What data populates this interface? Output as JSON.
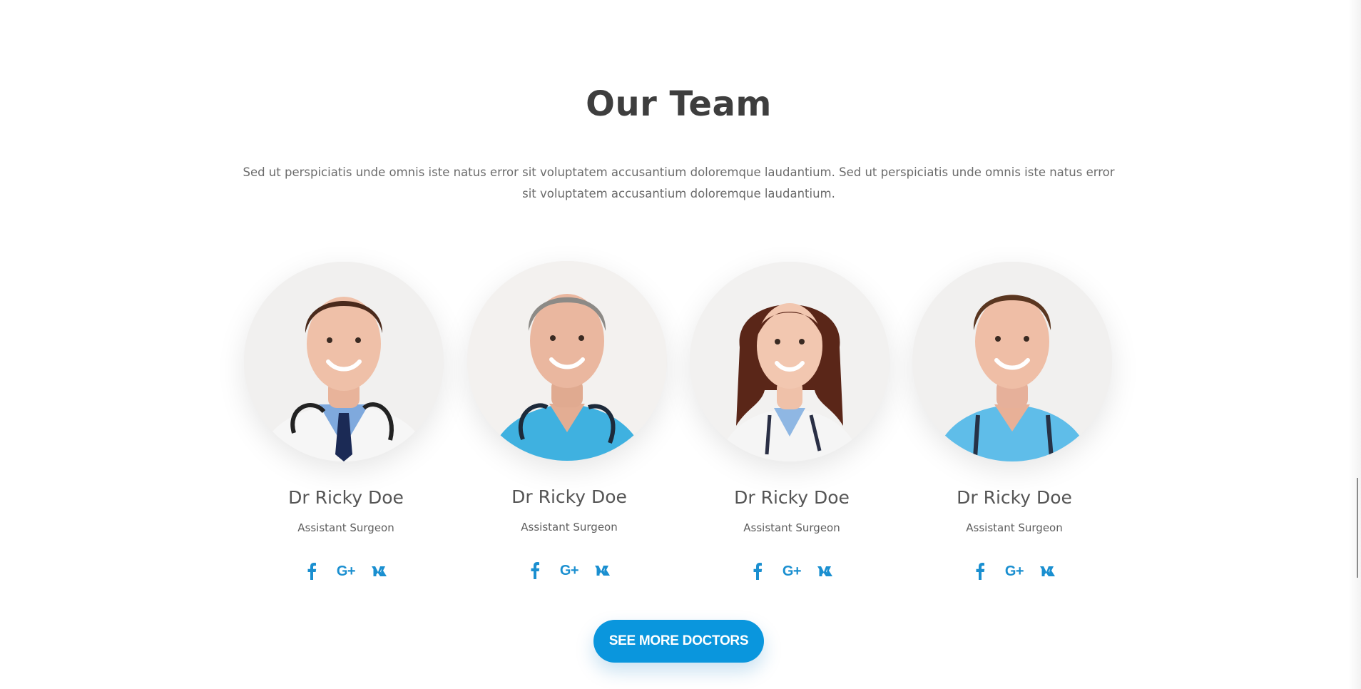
{
  "section": {
    "title": "Our Team",
    "intro": "Sed ut perspiciatis unde omnis iste natus error sit voluptatem accusantium doloremque laudantium. Sed ut perspiciatis unde omnis iste natus error sit voluptatem accusantium doloremque laudantium."
  },
  "team": [
    {
      "name": "Dr Ricky Doe",
      "role": "Assistant Surgeon",
      "portrait_icon": "doctor-portrait-white-coat-icon",
      "socials": [
        {
          "icon": "facebook-icon",
          "label": "f"
        },
        {
          "icon": "google-plus-icon",
          "label": "G+"
        },
        {
          "icon": "vk-icon",
          "label": "vk"
        }
      ]
    },
    {
      "name": "Dr Ricky Doe",
      "role": "Assistant Surgeon",
      "portrait_icon": "doctor-portrait-scrubs-grey-hair-icon",
      "socials": [
        {
          "icon": "facebook-icon",
          "label": "f"
        },
        {
          "icon": "google-plus-icon",
          "label": "G+"
        },
        {
          "icon": "vk-icon",
          "label": "vk"
        }
      ]
    },
    {
      "name": "Dr Ricky Doe",
      "role": "Assistant Surgeon",
      "portrait_icon": "doctor-portrait-woman-icon",
      "socials": [
        {
          "icon": "facebook-icon",
          "label": "f"
        },
        {
          "icon": "google-plus-icon",
          "label": "G+"
        },
        {
          "icon": "vk-icon",
          "label": "vk"
        }
      ]
    },
    {
      "name": "Dr Ricky Doe",
      "role": "Assistant Surgeon",
      "portrait_icon": "doctor-portrait-scrubs-icon",
      "socials": [
        {
          "icon": "facebook-icon",
          "label": "f"
        },
        {
          "icon": "google-plus-icon",
          "label": "G+"
        },
        {
          "icon": "vk-icon",
          "label": "vk"
        }
      ]
    }
  ],
  "cta": {
    "label": "SEE MORE DOCTORS"
  },
  "colors": {
    "accent": "#0a96dd",
    "social_icon": "#1a8fd0",
    "heading": "#3e3e3e",
    "body_text": "#6b6b6b"
  }
}
